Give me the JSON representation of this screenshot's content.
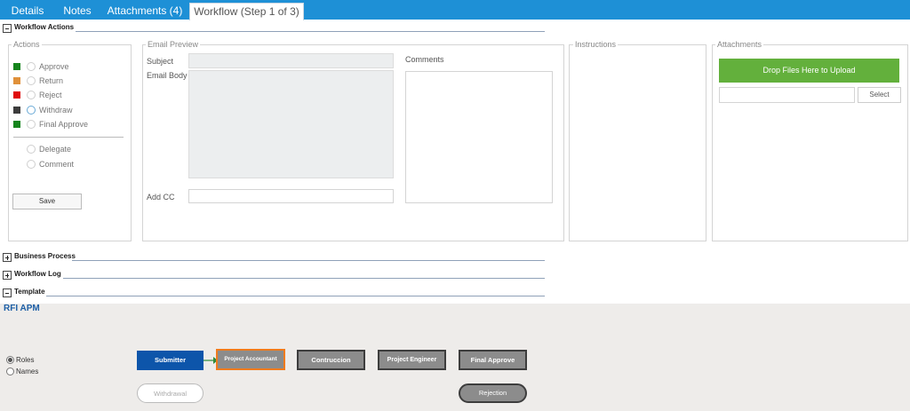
{
  "tabs": [
    {
      "label": "Details"
    },
    {
      "label": "Notes"
    },
    {
      "label": "Attachments (4)"
    },
    {
      "label": "Workflow (Step 1 of 3)",
      "active": true
    }
  ],
  "sections": {
    "workflow_actions": "Workflow Actions",
    "business_process": "Business Process",
    "workflow_log": "Workflow Log",
    "template": "Template"
  },
  "actions": {
    "legend": "Actions",
    "items": [
      {
        "label": "Approve",
        "color": "#15841c"
      },
      {
        "label": "Return",
        "color": "#e0903a"
      },
      {
        "label": "Reject",
        "color": "#e00b0b"
      },
      {
        "label": "Withdraw",
        "color": "#3c3c3c"
      },
      {
        "label": "Final Approve",
        "color": "#15841c"
      }
    ],
    "extra": [
      {
        "label": "Delegate"
      },
      {
        "label": "Comment"
      }
    ],
    "save": "Save"
  },
  "email": {
    "legend": "Email Preview",
    "subject_label": "Subject",
    "body_label": "Email Body",
    "cc_label": "Add CC",
    "comments_label": "Comments"
  },
  "instructions": {
    "legend": "Instructions"
  },
  "attachments": {
    "legend": "Attachments",
    "drop": "Drop Files Here to Upload",
    "drop_color": "#63b03c",
    "select": "Select"
  },
  "template": {
    "title": "RFI APM",
    "view_options": [
      {
        "label": "Roles",
        "selected": true
      },
      {
        "label": "Names",
        "selected": false
      }
    ],
    "nodes": {
      "submitter": "Submitter",
      "project_accountant": "Project Accountant",
      "construction": "Contruccion",
      "project_engineer": "Project Engineer",
      "final_approve": "Final Approve",
      "withdrawal": "Withdrawal",
      "rejection": "Rejection"
    },
    "colors": {
      "submitter": "#0d55aa",
      "highlight": "#f07b1d",
      "arrow": "#2e8b3a"
    }
  }
}
